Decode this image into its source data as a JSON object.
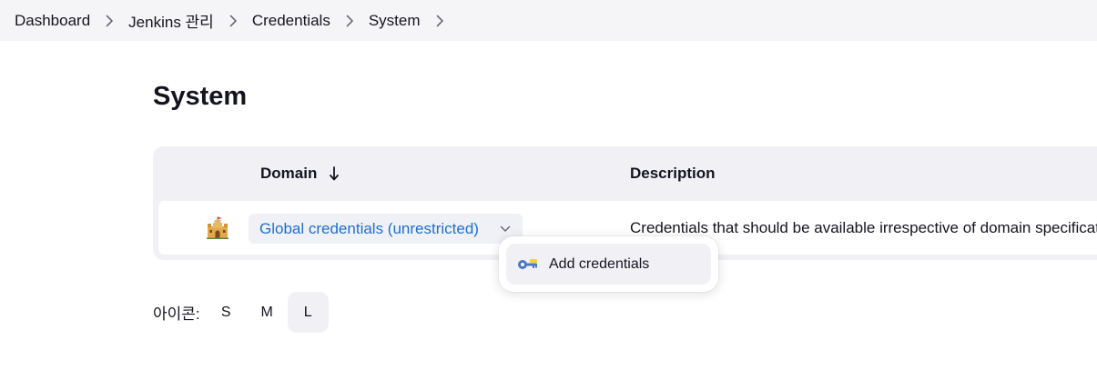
{
  "breadcrumb": {
    "items": [
      {
        "label": "Dashboard"
      },
      {
        "label": "Jenkins 관리"
      },
      {
        "label": "Credentials"
      },
      {
        "label": "System"
      }
    ]
  },
  "page": {
    "title": "System"
  },
  "table": {
    "columns": {
      "domain": "Domain",
      "description": "Description"
    },
    "sort_indicator": "down-arrow-icon",
    "rows": [
      {
        "icon": "castle-icon",
        "domain": "Global credentials (unrestricted)",
        "description": "Credentials that should be available irrespective of domain specification to requirements matching."
      }
    ]
  },
  "dropdown": {
    "items": [
      {
        "label": "Add credentials",
        "icon": "key-icon"
      }
    ]
  },
  "icon_size": {
    "label": "아이콘:",
    "options": [
      "S",
      "M",
      "L"
    ],
    "selected": "L"
  },
  "colors": {
    "link": "#1f6fd1",
    "breadcrumb_bg": "#f5f5f7",
    "table_bg": "#f1f1f5"
  }
}
